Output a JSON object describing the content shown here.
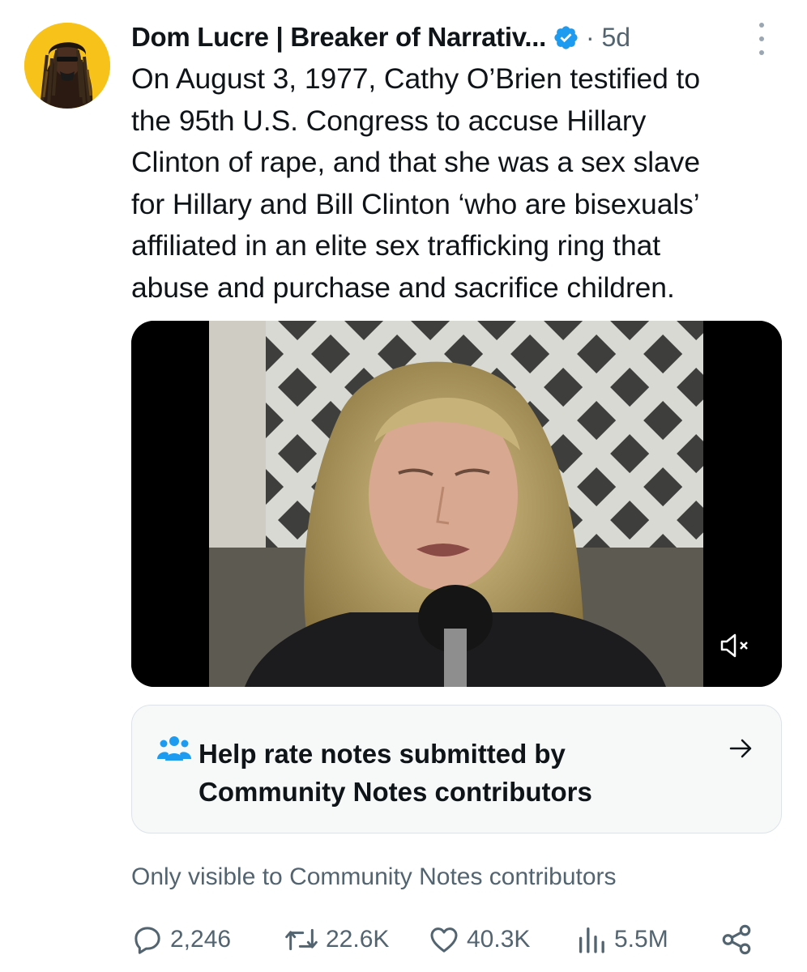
{
  "post": {
    "author_name": "Dom Lucre | Breaker of Narrativ...",
    "time": "· 5d",
    "text_lines": [
      "On August 3, 1977, Cathy O’Brien testified to",
      "the 95th U.S. Congress to accuse Hillary",
      "Clinton of rape, and that she was a sex slave",
      "for Hillary and Bill Clinton ‘who are bisexuals’",
      "affiliated in an elite sex trafficking ring that",
      "abuse and purchase and sacrifice children."
    ]
  },
  "community_notes": {
    "title_line1": "Help rate notes submitted by",
    "title_line2": "Community Notes contributors",
    "visibility_text": "Only visible to Community Notes contributors"
  },
  "metrics": {
    "replies": "2,246",
    "reposts": "22.6K",
    "likes": "40.3K",
    "views": "5.5M"
  },
  "colors": {
    "brand_blue": "#1d9bf0",
    "secondary_text": "#536471",
    "avatar_bg": "#f7c21a"
  },
  "icons": [
    "verified-badge-icon",
    "more-options-icon",
    "volume-muted-icon",
    "community-notes-icon",
    "arrow-right-icon",
    "reply-icon",
    "retweet-icon",
    "like-icon",
    "views-icon",
    "share-icon"
  ]
}
